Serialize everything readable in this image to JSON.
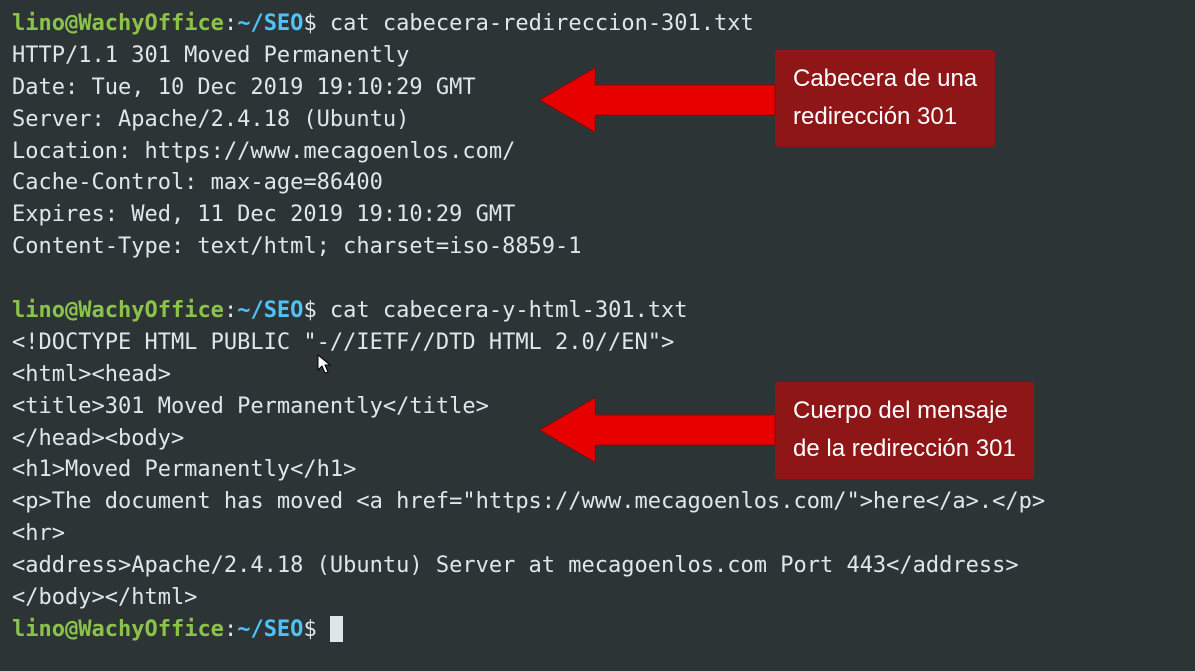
{
  "prompt": {
    "user": "lino",
    "host": "WachyOffice",
    "path_tilde": "~",
    "path": "SEO",
    "symbol": "$"
  },
  "command1": " cat cabecera-redireccion-301.txt",
  "output1": [
    "HTTP/1.1 301 Moved Permanently",
    "Date: Tue, 10 Dec 2019 19:10:29 GMT",
    "Server: Apache/2.4.18 (Ubuntu)",
    "Location: https://www.mecagoenlos.com/",
    "Cache-Control: max-age=86400",
    "Expires: Wed, 11 Dec 2019 19:10:29 GMT",
    "Content-Type: text/html; charset=iso-8859-1"
  ],
  "command2": " cat cabecera-y-html-301.txt",
  "output2": [
    "<!DOCTYPE HTML PUBLIC \"-//IETF//DTD HTML 2.0//EN\">",
    "<html><head>",
    "<title>301 Moved Permanently</title>",
    "</head><body>",
    "<h1>Moved Permanently</h1>",
    "<p>The document has moved <a href=\"https://www.mecagoenlos.com/\">here</a>.</p>",
    "<hr>",
    "<address>Apache/2.4.18 (Ubuntu) Server at mecagoenlos.com Port 443</address>",
    "</body></html>"
  ],
  "callout1": {
    "line1": "Cabecera de una",
    "line2": "redirección 301"
  },
  "callout2": {
    "line1": "Cuerpo del mensaje",
    "line2": "de la redirección 301"
  }
}
